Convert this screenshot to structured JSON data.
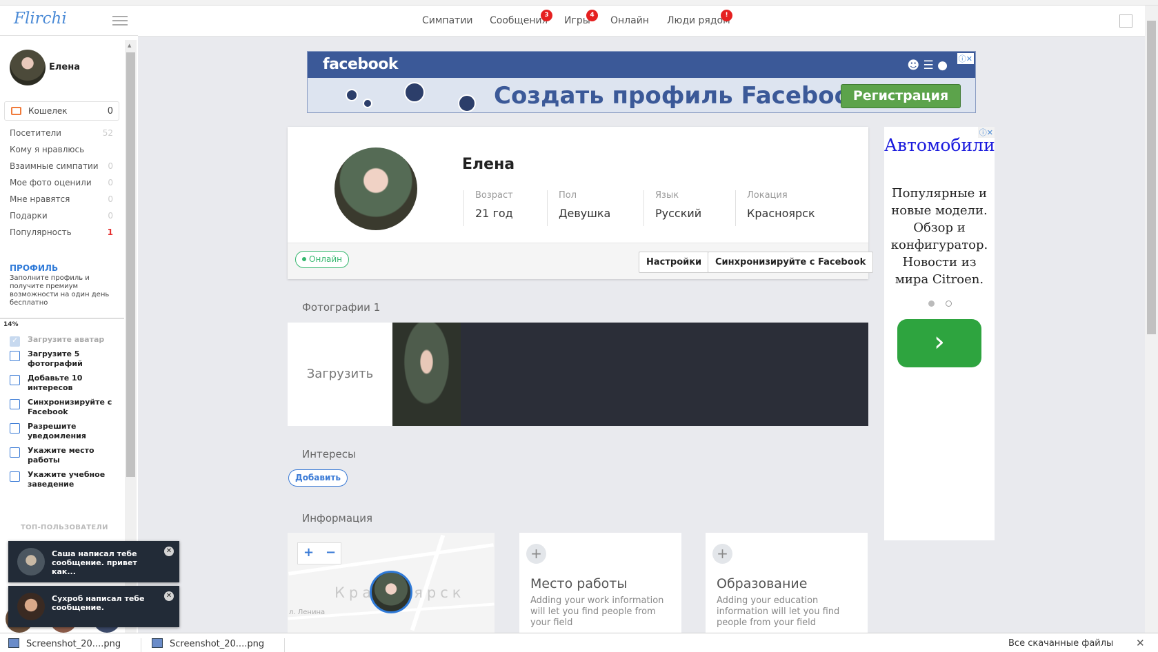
{
  "app": {
    "logo": "Flirchi"
  },
  "sidebar": {
    "user_name": "Елена",
    "wallet": {
      "label": "Кошелек",
      "count": "0"
    },
    "stats": [
      {
        "label": "Посетители",
        "count": "52"
      },
      {
        "label": "Кому я нравлюсь",
        "count": ""
      },
      {
        "label": "Взаимные симпатии",
        "count": "0"
      },
      {
        "label": "Мое фото оценили",
        "count": "0"
      },
      {
        "label": "Мне нравятся",
        "count": "0"
      },
      {
        "label": "Подарки",
        "count": "0"
      },
      {
        "label": "Популярность",
        "count": "1"
      }
    ],
    "profile_heading": "ПРОФИЛЬ",
    "profile_desc": "Заполните профиль и получите премиум возможности на один день бесплатно",
    "progress": "14%",
    "tasks": [
      {
        "label": "Загрузите аватар",
        "done": true
      },
      {
        "label": "Загрузите 5 фотографий",
        "done": false
      },
      {
        "label": "Добавьте 10 интересов",
        "done": false
      },
      {
        "label": "Синхронизируйте с Facebook",
        "done": false
      },
      {
        "label": "Разрешите уведомления",
        "done": false
      },
      {
        "label": "Укажите место работы",
        "done": false
      },
      {
        "label": "Укажите учебное заведение",
        "done": false
      }
    ],
    "top_users_heading": "ТОП-ПОЛЬЗОВАТЕЛИ"
  },
  "nav": {
    "items": [
      {
        "label": "Симпатии",
        "badge": ""
      },
      {
        "label": "Сообщения",
        "badge": "3"
      },
      {
        "label": "Игры",
        "badge": "4"
      },
      {
        "label": "Онлайн",
        "badge": ""
      },
      {
        "label": "Люди рядом",
        "badge": "!"
      }
    ]
  },
  "fb_ad": {
    "logo": "facebook",
    "slogan": "Создать профиль Facebook",
    "button": "Регистрация",
    "close": "ⓘ✕"
  },
  "profile": {
    "name": "Елена",
    "fields": [
      {
        "label": "Возраст",
        "value": "21 год"
      },
      {
        "label": "Пол",
        "value": "Девушка"
      },
      {
        "label": "Язык",
        "value": "Русский"
      },
      {
        "label": "Локация",
        "value": "Красноярск"
      }
    ],
    "status": "Онлайн",
    "settings_button": "Настройки",
    "sync_button": "Синхронизируйте с Facebook"
  },
  "photos": {
    "heading": "Фотографии 1",
    "upload_label": "Загрузить"
  },
  "interests": {
    "heading": "Интересы",
    "add_button": "Добавить"
  },
  "info": {
    "heading": "Информация",
    "map": {
      "city": "Красноярск",
      "street": "л. Ленина",
      "zoom_in": "+",
      "zoom_out": "−"
    },
    "work": {
      "title": "Место работы",
      "desc": "Adding your work information will let you find people from your field"
    },
    "education": {
      "title": "Образование",
      "desc": "Adding your education information will let you find people from your field"
    }
  },
  "right_ad": {
    "title": "Автомобили и Citroen",
    "text": "Популярные и новые модели. Обзор и конфигуратор. Новости из мира Citroen.",
    "close": "ⓘ✕",
    "go": "›"
  },
  "notifications": [
    {
      "text": "Саша написал тебе сообщение. привет как..."
    },
    {
      "text": "Сухроб написал тебе сообщение."
    }
  ],
  "downloads": {
    "items": [
      "Screenshot_20....png",
      "Screenshot_20....png"
    ],
    "show_all": "Все скачанные файлы"
  },
  "colors": {
    "accent": "#2f7ad8",
    "online": "#35b76e",
    "badge": "#e52020",
    "fb": "#3b5998"
  }
}
